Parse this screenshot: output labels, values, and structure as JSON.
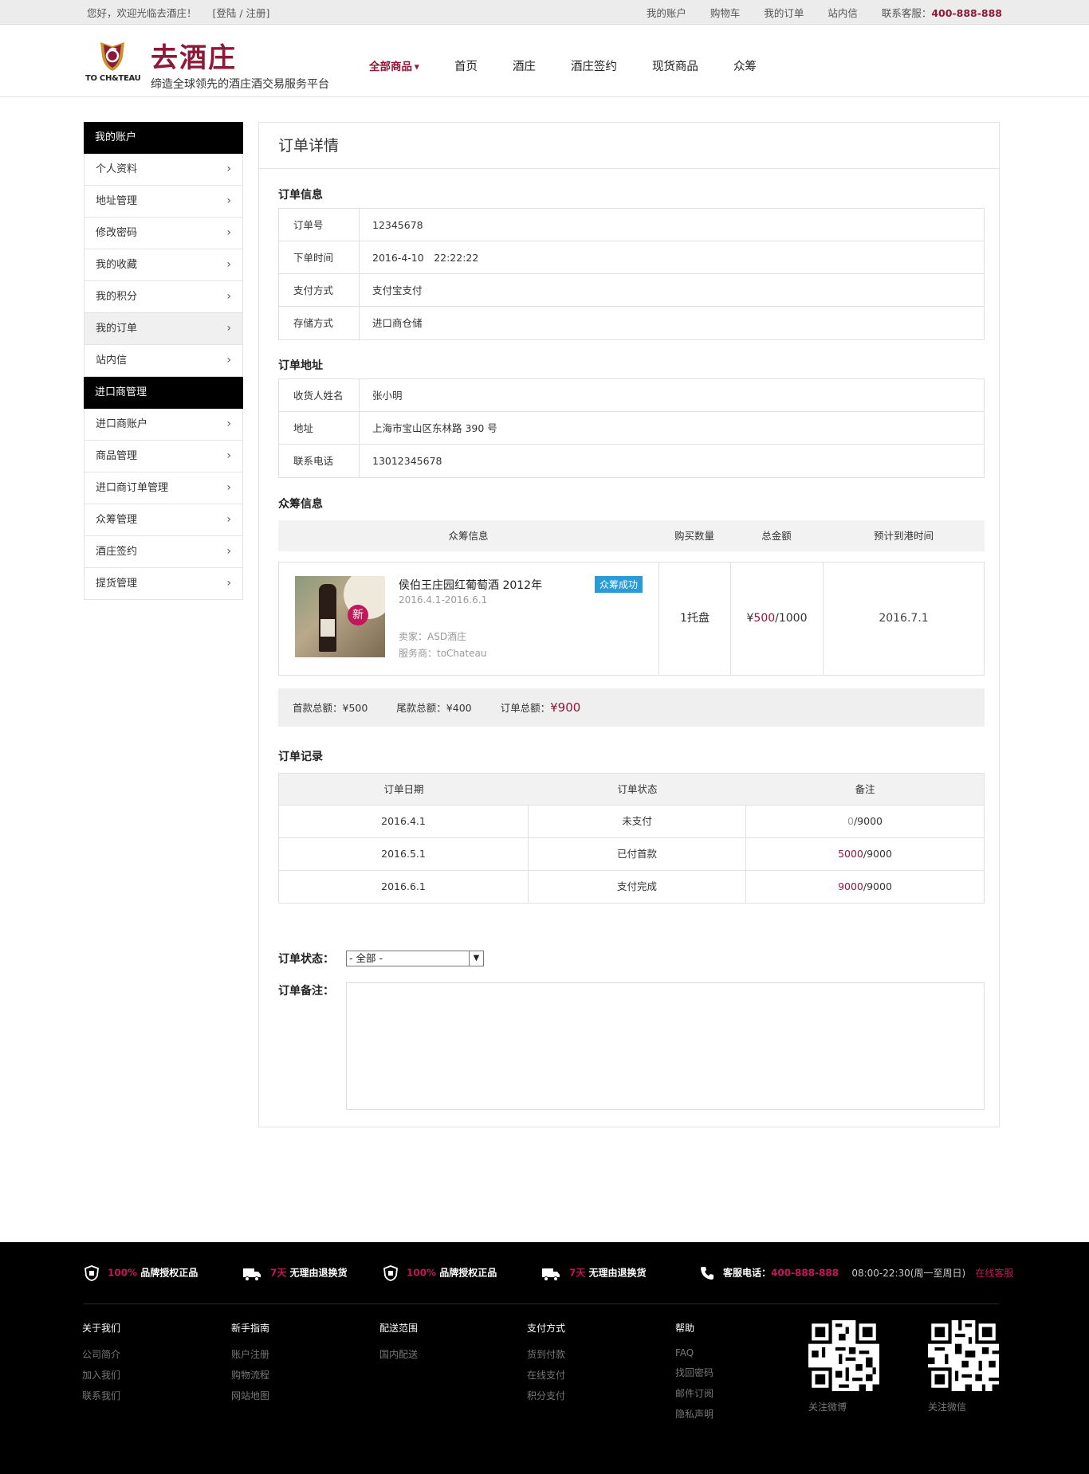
{
  "topbar": {
    "welcome": "您好，欢迎光临去酒庄！",
    "login": "[登陆 / 注册]",
    "links": [
      "我的账户",
      "购物车",
      "我的订单",
      "站内信"
    ],
    "service_label": "联系客服：",
    "service_phone": "400-888-888"
  },
  "header": {
    "logo_text": "TO CH&TEAU",
    "brand": "去酒庄",
    "slogan": "缔造全球领先的酒庄酒交易服务平台",
    "nav": [
      "全部商品",
      "首页",
      "酒庄",
      "酒庄签约",
      "现货商品",
      "众筹"
    ]
  },
  "sidebar": {
    "group1": "我的账户",
    "items1": [
      "个人资料",
      "地址管理",
      "修改密码",
      "我的收藏",
      "我的积分",
      "我的订单",
      "站内信"
    ],
    "group2": "进口商管理",
    "items2": [
      "进口商账户",
      "商品管理",
      "进口商订单管理",
      "众筹管理",
      "酒庄签约",
      "提货管理"
    ]
  },
  "main": {
    "title": "订单详情",
    "order_info": {
      "heading": "订单信息",
      "rows": [
        {
          "k": "订单号",
          "v": "12345678"
        },
        {
          "k": "下单时间",
          "v": "2016-4-10　22:22:22"
        },
        {
          "k": "支付方式",
          "v": "支付宝支付"
        },
        {
          "k": "存储方式",
          "v": "进口商仓储"
        }
      ]
    },
    "address": {
      "heading": "订单地址",
      "rows": [
        {
          "k": "收货人姓名",
          "v": "张小明"
        },
        {
          "k": "地址",
          "v": "上海市宝山区东林路 390 号"
        },
        {
          "k": "联系电话",
          "v": "13012345678"
        }
      ]
    },
    "crowd": {
      "heading": "众筹信息",
      "cols": [
        "众筹信息",
        "购买数量",
        "总金额",
        "预计到港时间"
      ],
      "product_name": "侯伯王庄园红葡萄酒 2012年",
      "product_dates": "2016.4.1-2016.6.1",
      "seller": "卖家：ASD酒庄",
      "provider": "服务商：toChateau",
      "badge": "众筹成功",
      "stamp": "新",
      "qty": "1托盘",
      "amount_prefix": "¥",
      "amount_paid": "500",
      "amount_total": "/1000",
      "eta": "2016.7.1"
    },
    "summary": {
      "deposit": "首款总额：¥500",
      "balance": "尾款总额：¥400",
      "total_label": "订单总额：",
      "total": "¥900"
    },
    "records": {
      "heading": "订单记录",
      "cols": [
        "订单日期",
        "订单状态",
        "备注"
      ],
      "rows": [
        {
          "date": "2016.4.1",
          "status": "未支付",
          "paid": "0",
          "total": "/9000"
        },
        {
          "date": "2016.5.1",
          "status": "已付首款",
          "paid": "5000",
          "total": "/9000"
        },
        {
          "date": "2016.6.1",
          "status": "支付完成",
          "paid": "9000",
          "total": "/9000"
        }
      ]
    },
    "form": {
      "status_label": "订单状态：",
      "status_value": "- 全部 -",
      "note_label": "订单备注："
    }
  },
  "footer": {
    "promises": [
      {
        "hl": "100%",
        "text": "品牌授权正品",
        "icon": "shield-icon"
      },
      {
        "hl": "7天",
        "text": "无理由退换货",
        "icon": "truck-icon"
      },
      {
        "hl": "100%",
        "text": "品牌授权正品",
        "icon": "shield-icon"
      },
      {
        "hl": "7天",
        "text": "无理由退换货",
        "icon": "truck-icon"
      }
    ],
    "hotline_label": "客服电话：",
    "hotline": "400-888-888",
    "hours": "08:00-22:30(周一至周日)",
    "online": "在线客服",
    "cols": [
      {
        "title": "关于我们",
        "links": [
          "公司简介",
          "加入我们",
          "联系我们"
        ]
      },
      {
        "title": "新手指南",
        "links": [
          "账户注册",
          "购物流程",
          "网站地图"
        ]
      },
      {
        "title": "配送范围",
        "links": [
          "国内配送"
        ]
      },
      {
        "title": "支付方式",
        "links": [
          "货到付款",
          "在线支付",
          "积分支付"
        ]
      },
      {
        "title": "帮助",
        "links": [
          "FAQ",
          "找回密码",
          "邮件订阅",
          "隐私声明"
        ]
      }
    ],
    "qr1": "关注微博",
    "qr2": "关注微信"
  },
  "colors": {
    "accent": "#8e1838",
    "badge": "#2a9bd8",
    "footer_red": "#c2185b"
  }
}
